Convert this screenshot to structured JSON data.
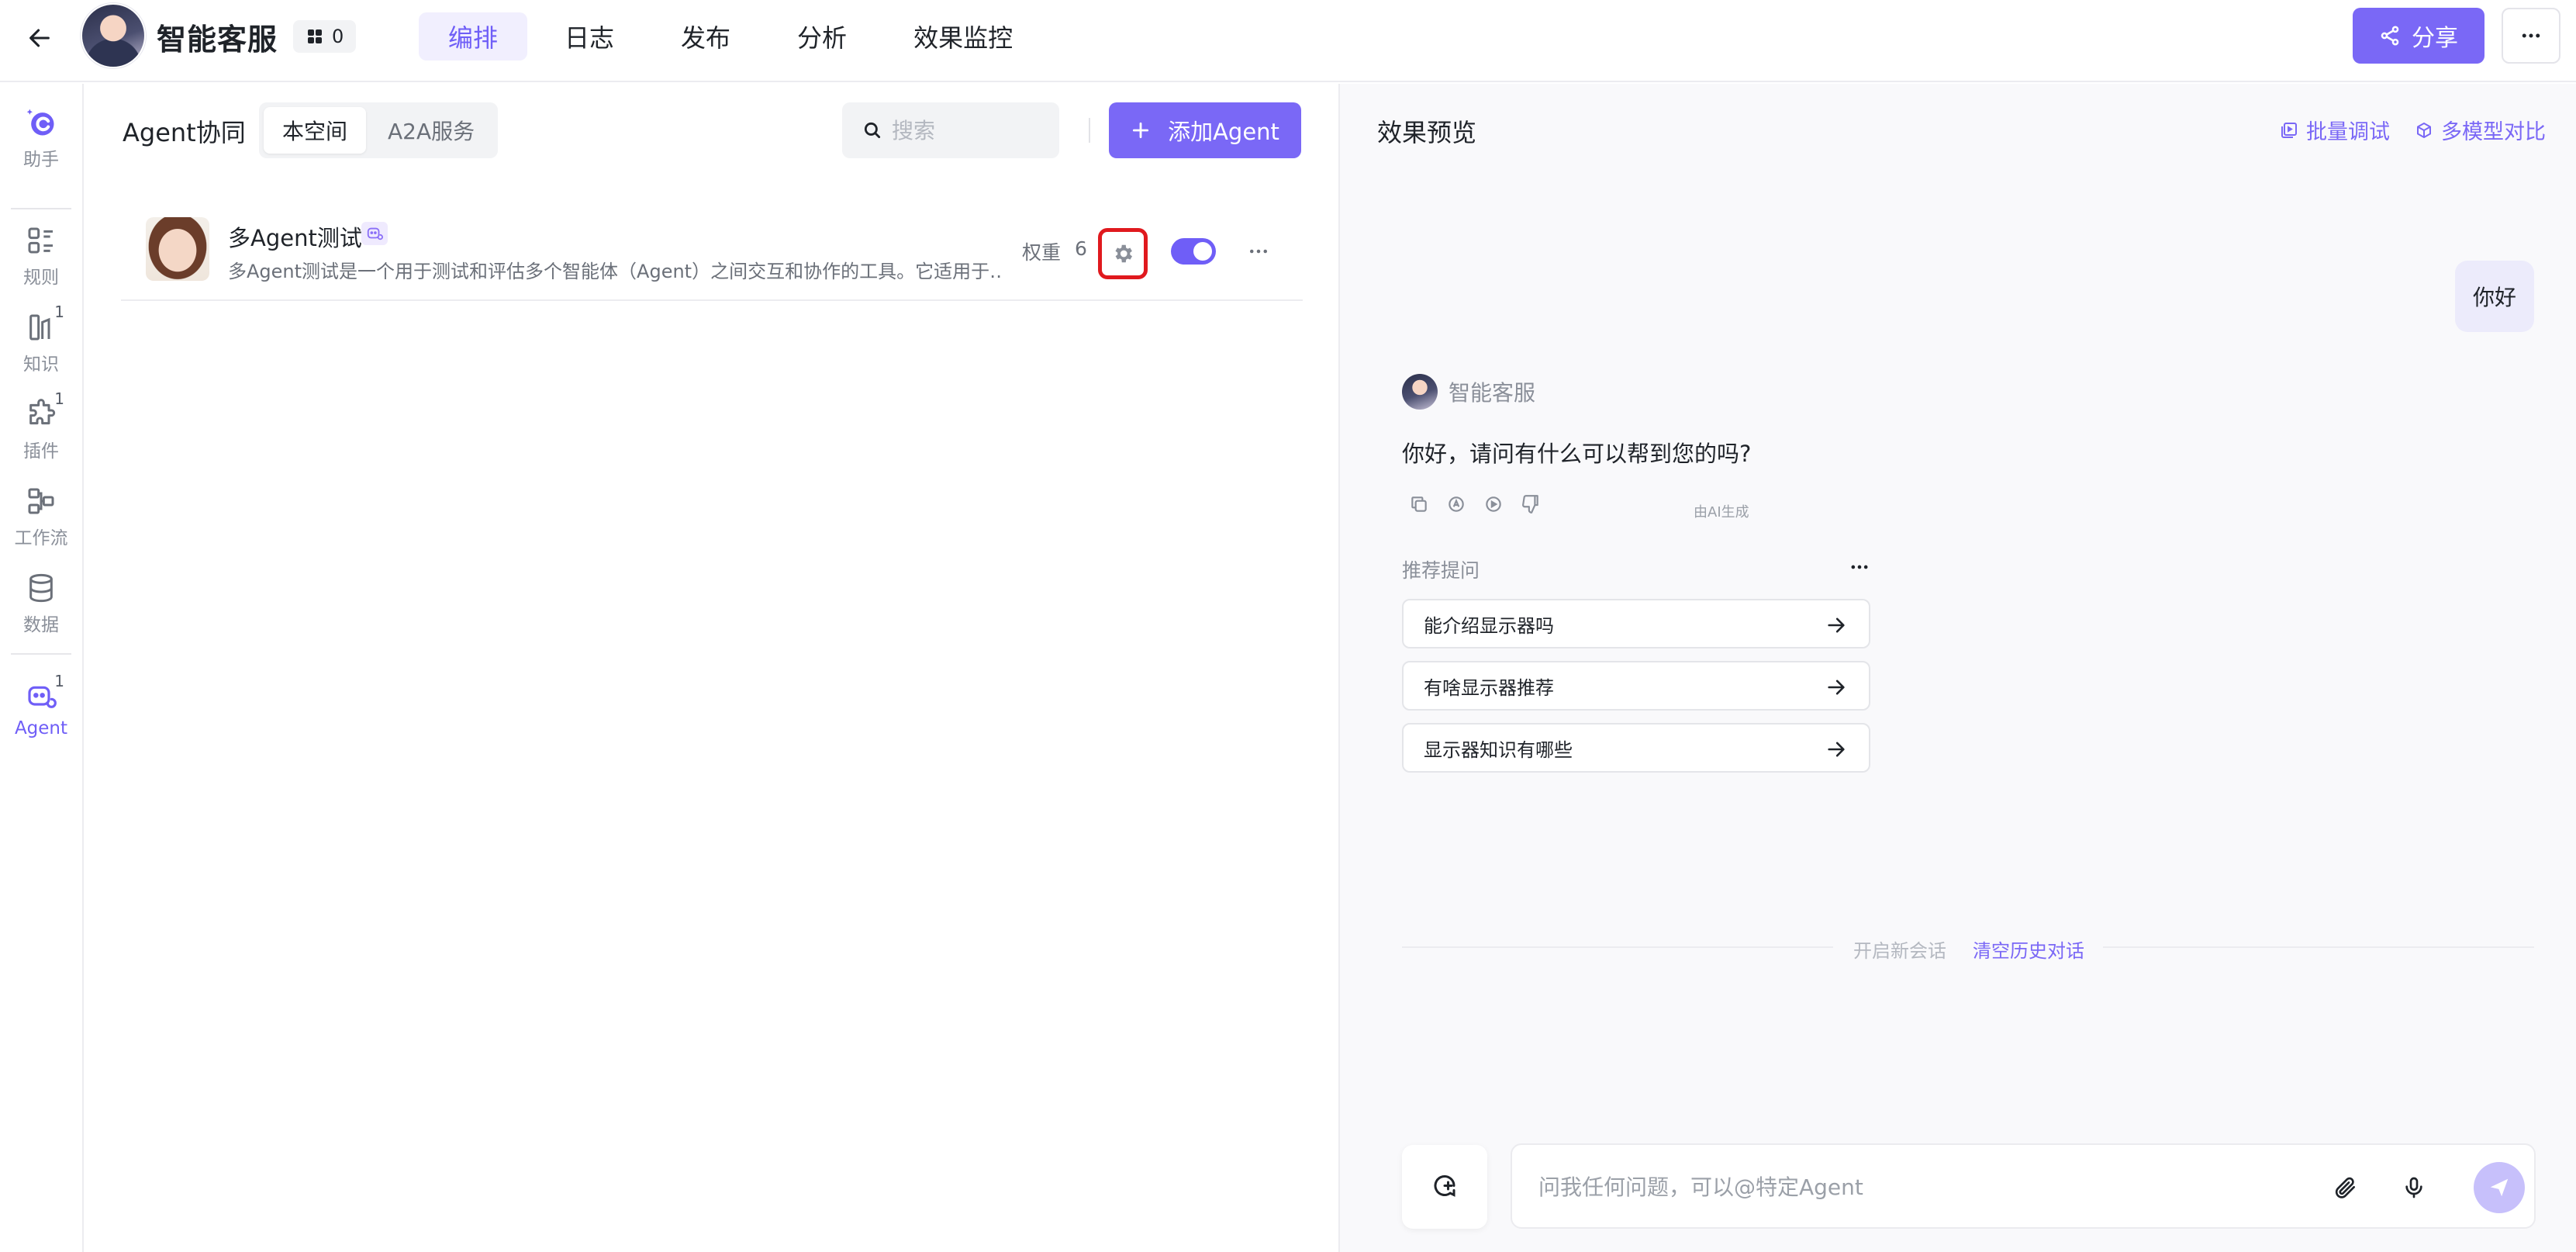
{
  "header": {
    "app_title": "智能客服",
    "badge_count": "0",
    "tabs": [
      {
        "label": "编排",
        "active": true
      },
      {
        "label": "日志",
        "active": false
      },
      {
        "label": "发布",
        "active": false
      },
      {
        "label": "分析",
        "active": false
      },
      {
        "label": "效果监控",
        "active": false
      }
    ],
    "share_label": "分享"
  },
  "sidebar": {
    "items": [
      {
        "label": "助手",
        "icon": "assistant-icon",
        "sup": ""
      },
      {
        "label": "规则",
        "icon": "rules-icon",
        "sup": ""
      },
      {
        "label": "知识",
        "icon": "knowledge-icon",
        "sup": "1"
      },
      {
        "label": "插件",
        "icon": "plugin-icon",
        "sup": "1"
      },
      {
        "label": "工作流",
        "icon": "workflow-icon",
        "sup": ""
      },
      {
        "label": "数据",
        "icon": "database-icon",
        "sup": ""
      },
      {
        "label": "Agent",
        "icon": "agent-icon",
        "sup": "1",
        "active": true
      }
    ]
  },
  "agent_panel": {
    "title": "Agent协同",
    "segments": [
      {
        "label": "本空间",
        "active": true
      },
      {
        "label": "A2A服务",
        "active": false
      }
    ],
    "search_placeholder": "搜索",
    "add_button": "添加Agent",
    "agents": [
      {
        "name": "多Agent测试",
        "description": "多Agent测试是一个用于测试和评估多个智能体（Agent）之间交互和协作的工具。它适用于…",
        "weight_label": "权重",
        "weight_value": "6",
        "enabled": true
      }
    ]
  },
  "preview": {
    "title": "效果预览",
    "batch_debug": "批量调试",
    "multi_model": "多模型对比",
    "user_message": "你好",
    "bot_name": "智能客服",
    "bot_message": "你好，请问有什么可以帮到您的吗?",
    "ai_generated": "由AI生成",
    "recommend_title": "推荐提问",
    "recommendations": [
      "能介绍显示器吗",
      "有啥显示器推荐",
      "显示器知识有哪些"
    ],
    "new_session": "开启新会话",
    "clear_history": "清空历史对话",
    "input_placeholder": "问我任何问题，可以@特定Agent"
  },
  "colors": {
    "accent": "#7a68f6",
    "accent_light": "#f1effe",
    "highlight_box": "#e0191e"
  }
}
